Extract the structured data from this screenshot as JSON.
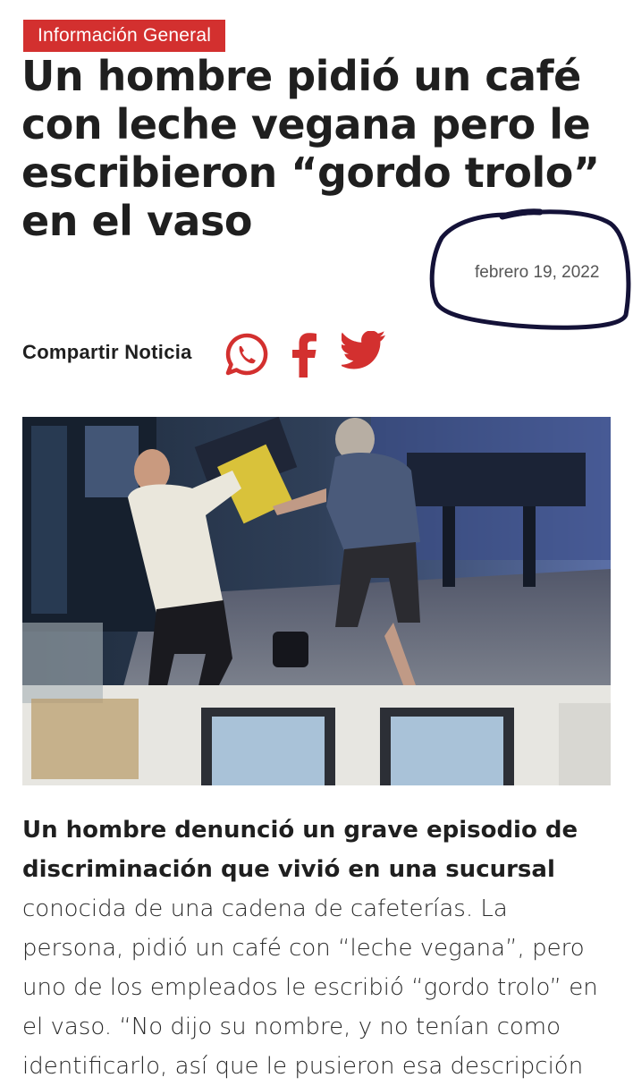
{
  "category": "Información General",
  "headline": "Un hombre pidió un café con leche vegana pero le escribieron “gordo trolo” en el vaso",
  "date": "febrero 19, 2022",
  "share": {
    "label": "Compartir Noticia",
    "icons": [
      "whatsapp-icon",
      "facebook-icon",
      "twitter-icon"
    ]
  },
  "lead": {
    "bold": "Un hombre denunció un grave episodio de discriminación que vivió en una sucursal",
    "rest": " conocida de una cadena de cafeterías. La persona, pidió un café con “leche vegana”, pero uno de los empleados le escribió “gordo trolo” en el vaso. “No dijo su nombre, y no tenían como identificarlo, así que le pusieron esa descripción"
  },
  "colors": {
    "accent": "#d3302f",
    "marker": "#141238",
    "text": "#1f1f1f"
  }
}
